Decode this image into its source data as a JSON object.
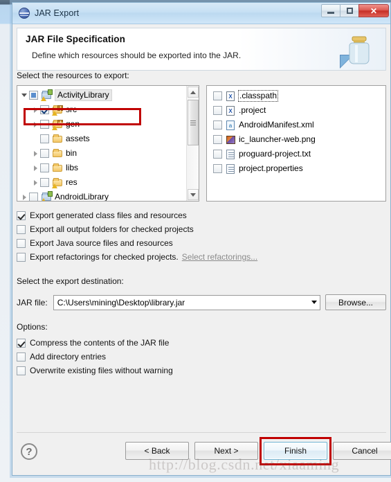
{
  "window": {
    "title": "JAR Export",
    "icon": "jar-export-icon",
    "controls": {
      "minimize": "minimize-icon",
      "maximize": "maximize-icon",
      "close": "✕"
    }
  },
  "header": {
    "title": "JAR File Specification",
    "subtitle": "Define which resources should be exported into the JAR.",
    "icon": "jar-bottle-icon"
  },
  "resources": {
    "label": "Select the resources to export:",
    "tree": [
      {
        "label": "ActivityLibrary",
        "depth": 0,
        "twisty": "open",
        "checkbox": "grayed",
        "icon": "java-project-icon",
        "selected": true
      },
      {
        "label": "src",
        "depth": 1,
        "twisty": "closed",
        "checkbox": "checked",
        "icon": "source-folder-icon",
        "selected": false
      },
      {
        "label": "gen",
        "depth": 1,
        "twisty": "closed",
        "checkbox": "unchecked",
        "icon": "source-folder-icon",
        "selected": false
      },
      {
        "label": "assets",
        "depth": 1,
        "twisty": "none",
        "checkbox": "unchecked",
        "icon": "folder-icon",
        "selected": false
      },
      {
        "label": "bin",
        "depth": 1,
        "twisty": "closed",
        "checkbox": "unchecked",
        "icon": "folder-icon",
        "selected": false
      },
      {
        "label": "libs",
        "depth": 1,
        "twisty": "closed",
        "checkbox": "unchecked",
        "icon": "folder-icon",
        "selected": false
      },
      {
        "label": "res",
        "depth": 1,
        "twisty": "closed",
        "checkbox": "unchecked",
        "icon": "folder-warning-icon",
        "selected": false
      },
      {
        "label": "AndroidLibrary",
        "depth": 0,
        "twisty": "closed",
        "checkbox": "unchecked",
        "icon": "java-project-icon",
        "selected": false
      }
    ],
    "files": [
      {
        "label": ".classpath",
        "icon": "xml-file-icon",
        "checkbox": "unchecked",
        "focused": true
      },
      {
        "label": ".project",
        "icon": "xml-file-icon",
        "checkbox": "unchecked",
        "focused": false
      },
      {
        "label": "AndroidManifest.xml",
        "icon": "manifest-file-icon",
        "checkbox": "unchecked",
        "focused": false
      },
      {
        "label": "ic_launcher-web.png",
        "icon": "image-file-icon",
        "checkbox": "unchecked",
        "focused": false
      },
      {
        "label": "proguard-project.txt",
        "icon": "text-file-icon",
        "checkbox": "unchecked",
        "focused": false
      },
      {
        "label": "project.properties",
        "icon": "text-file-icon",
        "checkbox": "unchecked",
        "focused": false
      }
    ]
  },
  "export_options": [
    {
      "label": "Export generated class files and resources",
      "checked": true
    },
    {
      "label": "Export all output folders for checked projects",
      "checked": false
    },
    {
      "label": "Export Java source files and resources",
      "checked": false
    },
    {
      "label": "Export refactorings for checked projects.",
      "checked": false,
      "link": "Select refactorings..."
    }
  ],
  "destination": {
    "label": "Select the export destination:",
    "jar_file_label": "JAR file:",
    "jar_file_value": "C:\\Users\\mining\\Desktop\\library.jar",
    "browse_label": "Browse..."
  },
  "options": {
    "label": "Options:",
    "items": [
      {
        "label": "Compress the contents of the JAR file",
        "checked": true
      },
      {
        "label": "Add directory entries",
        "checked": false
      },
      {
        "label": "Overwrite existing files without warning",
        "checked": false
      }
    ]
  },
  "footer": {
    "help_label": "?",
    "back_label": "< Back",
    "next_label": "Next >",
    "finish_label": "Finish",
    "cancel_label": "Cancel"
  },
  "watermark": "http://blog.csdn.net/xiaaming",
  "colors": {
    "accent": "#c00000",
    "titlebar": "#c6e0f4",
    "close_button": "#c62f27",
    "focus_border": "#6fb3d2"
  }
}
